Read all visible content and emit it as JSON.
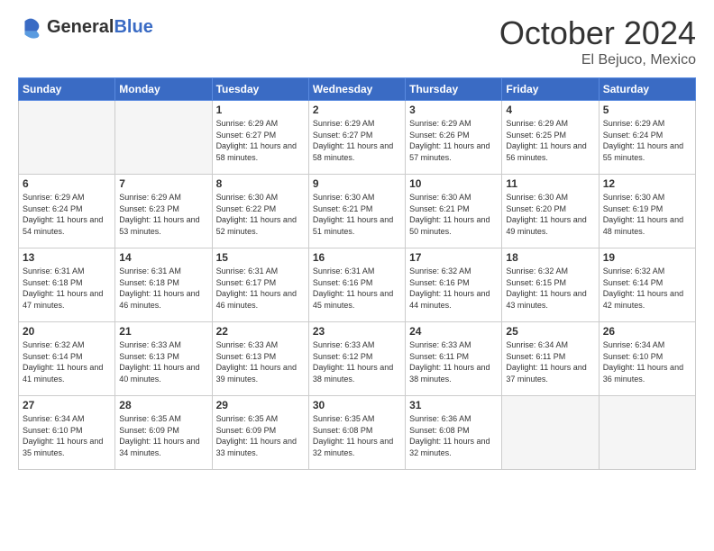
{
  "header": {
    "logo_general": "General",
    "logo_blue": "Blue",
    "month": "October 2024",
    "location": "El Bejuco, Mexico"
  },
  "days_of_week": [
    "Sunday",
    "Monday",
    "Tuesday",
    "Wednesday",
    "Thursday",
    "Friday",
    "Saturday"
  ],
  "weeks": [
    [
      {
        "day": "",
        "empty": true
      },
      {
        "day": "",
        "empty": true
      },
      {
        "day": "1",
        "sunrise": "Sunrise: 6:29 AM",
        "sunset": "Sunset: 6:27 PM",
        "daylight": "Daylight: 11 hours and 58 minutes."
      },
      {
        "day": "2",
        "sunrise": "Sunrise: 6:29 AM",
        "sunset": "Sunset: 6:27 PM",
        "daylight": "Daylight: 11 hours and 58 minutes."
      },
      {
        "day": "3",
        "sunrise": "Sunrise: 6:29 AM",
        "sunset": "Sunset: 6:26 PM",
        "daylight": "Daylight: 11 hours and 57 minutes."
      },
      {
        "day": "4",
        "sunrise": "Sunrise: 6:29 AM",
        "sunset": "Sunset: 6:25 PM",
        "daylight": "Daylight: 11 hours and 56 minutes."
      },
      {
        "day": "5",
        "sunrise": "Sunrise: 6:29 AM",
        "sunset": "Sunset: 6:24 PM",
        "daylight": "Daylight: 11 hours and 55 minutes."
      }
    ],
    [
      {
        "day": "6",
        "sunrise": "Sunrise: 6:29 AM",
        "sunset": "Sunset: 6:24 PM",
        "daylight": "Daylight: 11 hours and 54 minutes."
      },
      {
        "day": "7",
        "sunrise": "Sunrise: 6:29 AM",
        "sunset": "Sunset: 6:23 PM",
        "daylight": "Daylight: 11 hours and 53 minutes."
      },
      {
        "day": "8",
        "sunrise": "Sunrise: 6:30 AM",
        "sunset": "Sunset: 6:22 PM",
        "daylight": "Daylight: 11 hours and 52 minutes."
      },
      {
        "day": "9",
        "sunrise": "Sunrise: 6:30 AM",
        "sunset": "Sunset: 6:21 PM",
        "daylight": "Daylight: 11 hours and 51 minutes."
      },
      {
        "day": "10",
        "sunrise": "Sunrise: 6:30 AM",
        "sunset": "Sunset: 6:21 PM",
        "daylight": "Daylight: 11 hours and 50 minutes."
      },
      {
        "day": "11",
        "sunrise": "Sunrise: 6:30 AM",
        "sunset": "Sunset: 6:20 PM",
        "daylight": "Daylight: 11 hours and 49 minutes."
      },
      {
        "day": "12",
        "sunrise": "Sunrise: 6:30 AM",
        "sunset": "Sunset: 6:19 PM",
        "daylight": "Daylight: 11 hours and 48 minutes."
      }
    ],
    [
      {
        "day": "13",
        "sunrise": "Sunrise: 6:31 AM",
        "sunset": "Sunset: 6:18 PM",
        "daylight": "Daylight: 11 hours and 47 minutes."
      },
      {
        "day": "14",
        "sunrise": "Sunrise: 6:31 AM",
        "sunset": "Sunset: 6:18 PM",
        "daylight": "Daylight: 11 hours and 46 minutes."
      },
      {
        "day": "15",
        "sunrise": "Sunrise: 6:31 AM",
        "sunset": "Sunset: 6:17 PM",
        "daylight": "Daylight: 11 hours and 46 minutes."
      },
      {
        "day": "16",
        "sunrise": "Sunrise: 6:31 AM",
        "sunset": "Sunset: 6:16 PM",
        "daylight": "Daylight: 11 hours and 45 minutes."
      },
      {
        "day": "17",
        "sunrise": "Sunrise: 6:32 AM",
        "sunset": "Sunset: 6:16 PM",
        "daylight": "Daylight: 11 hours and 44 minutes."
      },
      {
        "day": "18",
        "sunrise": "Sunrise: 6:32 AM",
        "sunset": "Sunset: 6:15 PM",
        "daylight": "Daylight: 11 hours and 43 minutes."
      },
      {
        "day": "19",
        "sunrise": "Sunrise: 6:32 AM",
        "sunset": "Sunset: 6:14 PM",
        "daylight": "Daylight: 11 hours and 42 minutes."
      }
    ],
    [
      {
        "day": "20",
        "sunrise": "Sunrise: 6:32 AM",
        "sunset": "Sunset: 6:14 PM",
        "daylight": "Daylight: 11 hours and 41 minutes."
      },
      {
        "day": "21",
        "sunrise": "Sunrise: 6:33 AM",
        "sunset": "Sunset: 6:13 PM",
        "daylight": "Daylight: 11 hours and 40 minutes."
      },
      {
        "day": "22",
        "sunrise": "Sunrise: 6:33 AM",
        "sunset": "Sunset: 6:13 PM",
        "daylight": "Daylight: 11 hours and 39 minutes."
      },
      {
        "day": "23",
        "sunrise": "Sunrise: 6:33 AM",
        "sunset": "Sunset: 6:12 PM",
        "daylight": "Daylight: 11 hours and 38 minutes."
      },
      {
        "day": "24",
        "sunrise": "Sunrise: 6:33 AM",
        "sunset": "Sunset: 6:11 PM",
        "daylight": "Daylight: 11 hours and 38 minutes."
      },
      {
        "day": "25",
        "sunrise": "Sunrise: 6:34 AM",
        "sunset": "Sunset: 6:11 PM",
        "daylight": "Daylight: 11 hours and 37 minutes."
      },
      {
        "day": "26",
        "sunrise": "Sunrise: 6:34 AM",
        "sunset": "Sunset: 6:10 PM",
        "daylight": "Daylight: 11 hours and 36 minutes."
      }
    ],
    [
      {
        "day": "27",
        "sunrise": "Sunrise: 6:34 AM",
        "sunset": "Sunset: 6:10 PM",
        "daylight": "Daylight: 11 hours and 35 minutes."
      },
      {
        "day": "28",
        "sunrise": "Sunrise: 6:35 AM",
        "sunset": "Sunset: 6:09 PM",
        "daylight": "Daylight: 11 hours and 34 minutes."
      },
      {
        "day": "29",
        "sunrise": "Sunrise: 6:35 AM",
        "sunset": "Sunset: 6:09 PM",
        "daylight": "Daylight: 11 hours and 33 minutes."
      },
      {
        "day": "30",
        "sunrise": "Sunrise: 6:35 AM",
        "sunset": "Sunset: 6:08 PM",
        "daylight": "Daylight: 11 hours and 32 minutes."
      },
      {
        "day": "31",
        "sunrise": "Sunrise: 6:36 AM",
        "sunset": "Sunset: 6:08 PM",
        "daylight": "Daylight: 11 hours and 32 minutes."
      },
      {
        "day": "",
        "empty": true
      },
      {
        "day": "",
        "empty": true
      }
    ]
  ]
}
